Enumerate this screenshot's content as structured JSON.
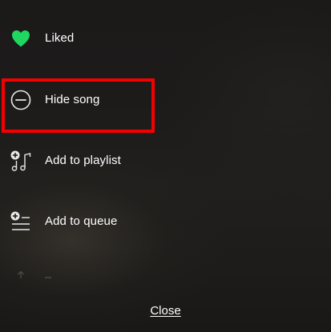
{
  "menu": {
    "items": [
      {
        "label": "Liked",
        "icon": "heart-filled-icon",
        "icon_color": "#1ed760"
      },
      {
        "label": "Hide song",
        "icon": "minus-circle-icon",
        "highlighted": true
      },
      {
        "label": "Add to playlist",
        "icon": "add-to-playlist-icon"
      },
      {
        "label": "Add to queue",
        "icon": "add-to-queue-icon"
      }
    ]
  },
  "close_label": "Close",
  "colors": {
    "accent": "#1ed760",
    "highlight": "#f40000",
    "text": "#ffffff"
  }
}
